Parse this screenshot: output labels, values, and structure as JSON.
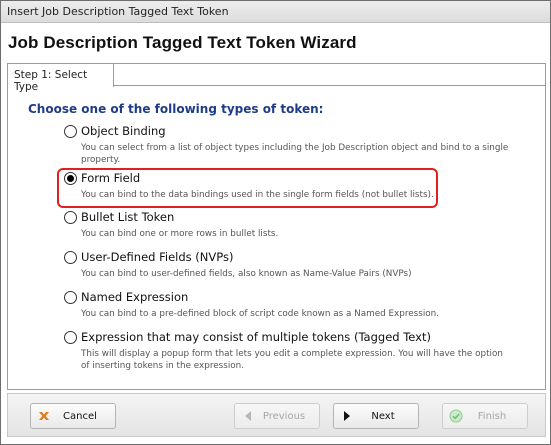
{
  "window": {
    "title": "Insert Job Description Tagged Text Token"
  },
  "wizard": {
    "heading": "Job Description Tagged Text Token Wizard",
    "tab": "Step 1: Select Type",
    "prompt": "Choose one of the following types of token:"
  },
  "options": [
    {
      "label": "Object Binding",
      "description": "You can select from a list of object types including the Job Description object and bind to a single property.",
      "selected": false
    },
    {
      "label": "Form Field",
      "description": "You can bind to the data bindings used in the single form fields (not bullet lists).",
      "selected": true
    },
    {
      "label": "Bullet List Token",
      "description": "You can bind one or more rows in bullet lists.",
      "selected": false
    },
    {
      "label": "User-Defined Fields (NVPs)",
      "description": "You can bind to user-defined fields, also known as Name-Value Pairs (NVPs)",
      "selected": false
    },
    {
      "label": "Named Expression",
      "description": "You can bind to a pre-defined block of script code known as a Named Expression.",
      "selected": false
    },
    {
      "label": "Expression that may consist of multiple tokens (Tagged Text)",
      "description": "This will display a popup form that lets you edit a complete expression. You will have the option of inserting tokens in the expression.",
      "selected": false
    }
  ],
  "footer": {
    "cancel_label": "Cancel",
    "previous_label": "Previous",
    "next_label": "Next",
    "finish_label": "Finish"
  },
  "colors": {
    "prompt": "#1f3c88",
    "highlight": "#e02020",
    "cancel_icon": "#e07b1a",
    "finish_icon": "#6fbf6f"
  },
  "icons": {
    "cancel": "cancel-x-icon",
    "previous": "previous-arrow-icon",
    "next": "next-arrow-icon",
    "finish": "finish-check-icon"
  }
}
